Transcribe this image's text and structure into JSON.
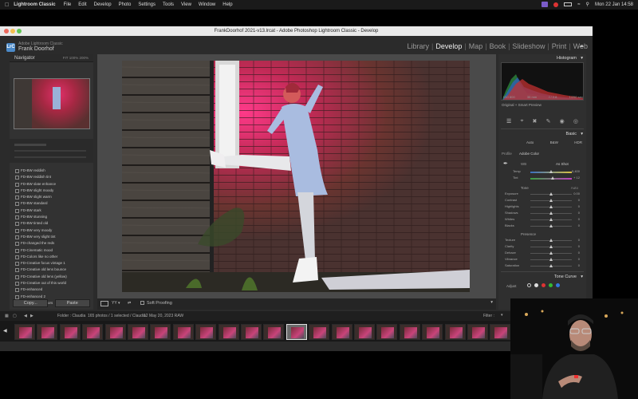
{
  "mac_menu": {
    "app": "Lightroom Classic",
    "items": [
      "File",
      "Edit",
      "Develop",
      "Photo",
      "Settings",
      "Tools",
      "View",
      "Window",
      "Help"
    ],
    "clock": "Mon 22 Jan  14:58"
  },
  "window_title": "FrankDoorhof 2021-v13.lrcat - Adobe Photoshop Lightroom Classic - Develop",
  "identity": {
    "badge": "LrC",
    "product": "Adobe Lightroom Classic",
    "user": "Frank Doorhof"
  },
  "modules": [
    "Library",
    "Develop",
    "Map",
    "Book",
    "Slideshow",
    "Print",
    "Web"
  ],
  "active_module": "Develop",
  "left_panel": {
    "navigator_title": "Navigator",
    "navigator_zoom": [
      "FIT",
      "100%",
      "200%"
    ],
    "presets": [
      "FD-BW reddish",
      "FD-BW reddish tint",
      "FD-BW slate enhance",
      "FD-BW slight moody",
      "FD-BW slight warm",
      "FD-BW standard",
      "FD-BW stark",
      "FD-BW stunning",
      "FD-BW tinted old",
      "FD-BW very moody",
      "FD-BW very slight tint",
      "FD-changed the reds",
      "FD-Cinematic mood",
      "FD-Colors like no other",
      "FD-Creative focus vintage 1",
      "FD-Creative old lens bounce",
      "FD-Creative old lens (yellow)",
      "FD-Creative out of this world",
      "FD-enhanced",
      "FD-enhanced 2",
      "FD-faded film colors"
    ],
    "copy_label": "Copy...",
    "paste_label": "Paste"
  },
  "toolbar": {
    "soft_proofing": "Soft Proofing"
  },
  "right_panel": {
    "histogram_title": "Histogram",
    "histogram_info": [
      "ISO 800",
      "35 mm",
      "f / 2.8",
      "1/250 sec"
    ],
    "original_label": "Original + Smart Preview",
    "basic_title": "Basic",
    "treatment": [
      "Auto",
      "B&W",
      "HDR"
    ],
    "profile_label": "Profile",
    "profile_value": "Adobe Color",
    "wb_label": "WB",
    "wb_value": "As Shot",
    "temp_label": "Temp",
    "temp_value": "5,400",
    "tint_label": "Tint",
    "tint_value": "+ 12",
    "tone_label": "Tone",
    "tone_auto": "Auto",
    "tone_sliders": [
      {
        "label": "Exposure",
        "value": "0.00",
        "pos": 0.5
      },
      {
        "label": "Contrast",
        "value": "0",
        "pos": 0.5
      },
      {
        "label": "Highlights",
        "value": "0",
        "pos": 0.5
      },
      {
        "label": "Shadows",
        "value": "0",
        "pos": 0.5
      },
      {
        "label": "Whites",
        "value": "0",
        "pos": 0.5
      },
      {
        "label": "Blacks",
        "value": "0",
        "pos": 0.5
      }
    ],
    "presence_label": "Presence",
    "presence_sliders": [
      {
        "label": "Texture",
        "value": "0",
        "pos": 0.5
      },
      {
        "label": "Clarity",
        "value": "0",
        "pos": 0.5
      },
      {
        "label": "Dehaze",
        "value": "0",
        "pos": 0.5
      },
      {
        "label": "Vibrance",
        "value": "0",
        "pos": 0.5
      },
      {
        "label": "Saturation",
        "value": "0",
        "pos": 0.5
      }
    ],
    "tone_curve_title": "Tone Curve",
    "adjust_label": "Adjust"
  },
  "filmstrip": {
    "source_label": "Folder : Claudia",
    "count_label": "165 photos / 1 selected / Claudia",
    "filename": "12 May 20, 2023 RAW",
    "filter_label": "Filter :",
    "thumb_count": 22,
    "selected_index": 12
  },
  "colors": {
    "accent": "#4b8ac9",
    "panel": "#2f2f2f",
    "center_bg": "#4a4a4a"
  }
}
